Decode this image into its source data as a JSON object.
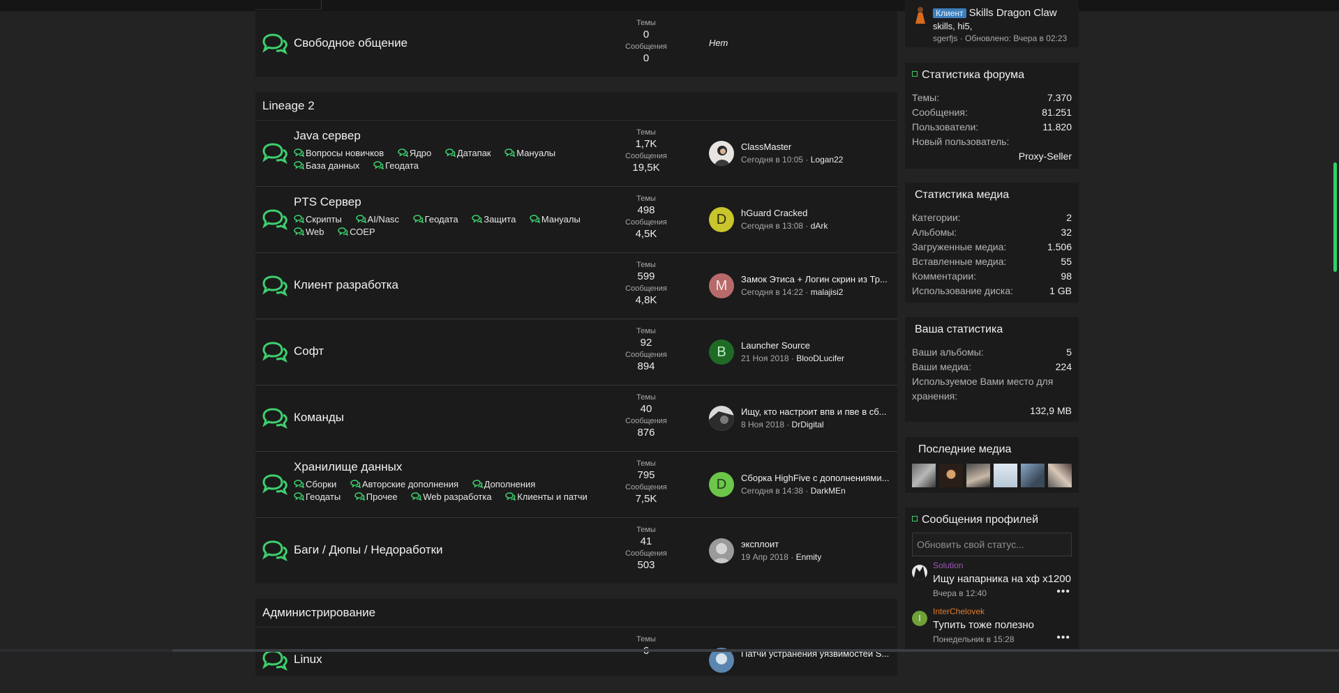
{
  "forum": {
    "lbl_threads": "Темы",
    "lbl_messages": "Сообщения",
    "top_node": {
      "title": "Свободное общение",
      "threads": "0",
      "messages": "0",
      "last_none": "Нет"
    },
    "lineage": {
      "title": "Lineage 2",
      "nodes": [
        {
          "title": "Java сервер",
          "subforums": [
            "Вопросы новичков",
            "Ядро",
            "Датапак",
            "Мануалы",
            "База данных",
            "Геодата"
          ],
          "threads": "1,7K",
          "messages": "19,5K",
          "last_title": "ClassMaster",
          "last_date": "Сегодня в 10:05",
          "last_user": "Logan22"
        },
        {
          "title": "PTS Сервер",
          "subforums": [
            "Скрипты",
            "AI/Nasc",
            "Геодата",
            "Защита",
            "Мануалы",
            "Web",
            "СОЕР"
          ],
          "threads": "498",
          "messages": "4,5K",
          "avatar_letter": "D",
          "last_title": "hGuard Cracked",
          "last_date": "Сегодня в 13:08",
          "last_user": "dArk"
        },
        {
          "title": "Клиент разработка",
          "threads": "599",
          "messages": "4,8K",
          "avatar_letter": "M",
          "last_title": "Замок Этиса + Логин скрин из Тр...",
          "last_date": "Сегодня в 14:22",
          "last_user": "malajisi2"
        },
        {
          "title": "Софт",
          "threads": "92",
          "messages": "894",
          "avatar_letter": "B",
          "last_title": "Launcher Source",
          "last_date": "21 Ноя 2018",
          "last_user": "BlooDLucifer"
        },
        {
          "title": "Команды",
          "threads": "40",
          "messages": "876",
          "last_title": "Ищу, кто настроит впв и пве в сб...",
          "last_date": "8 Ноя 2018",
          "last_user": "DrDigital"
        },
        {
          "title": "Хранилище данных",
          "subforums": [
            "Сборки",
            "Авторские дополнения",
            "Дополнения",
            "Геодаты",
            "Прочее",
            "Web разработка",
            "Клиенты и патчи"
          ],
          "threads": "795",
          "messages": "7,5K",
          "avatar_letter": "D",
          "last_title": "Сборка HighFive с дополнениями...",
          "last_date": "Сегодня в 14:38",
          "last_user": "DarkMEn"
        },
        {
          "title": "Баги / Дюпы / Недоработки",
          "threads": "41",
          "messages": "503",
          "last_title": "эксплоит",
          "last_date": "19 Апр 2018",
          "last_user": "Enmity"
        }
      ]
    },
    "admin": {
      "title": "Администрирование",
      "node": {
        "title": "Linux",
        "threads": "6",
        "last_title": "Патчи устранения уязвимостей S..."
      }
    }
  },
  "sidebar": {
    "top_post": {
      "prefix": "Клиент",
      "title": "Skills Dragon Claw",
      "snippet": "skills, hi5,",
      "meta": "sgerfjs · Обновлено: Вчера в 02:23"
    },
    "forum_stats": {
      "title": "Статистика форума",
      "rows": [
        {
          "k": "Темы:",
          "v": "7.370"
        },
        {
          "k": "Сообщения:",
          "v": "81.251"
        },
        {
          "k": "Пользователи:",
          "v": "11.820"
        },
        {
          "k": "Новый пользователь:",
          "v": ""
        }
      ],
      "new_user": "Proxy-Seller"
    },
    "media_stats": {
      "title": "Статистика медиа",
      "rows": [
        {
          "k": "Категории:",
          "v": "2"
        },
        {
          "k": "Альбомы:",
          "v": "32"
        },
        {
          "k": "Загруженные медиа:",
          "v": "1.506"
        },
        {
          "k": "Вставленные медиа:",
          "v": "55"
        },
        {
          "k": "Комментарии:",
          "v": "98"
        },
        {
          "k": "Использование диска:",
          "v": "1 GB"
        }
      ]
    },
    "your_stats": {
      "title": "Ваша статистика",
      "rows": [
        {
          "k": "Ваши альбомы:",
          "v": "5"
        },
        {
          "k": "Ваши медиа:",
          "v": "224"
        }
      ],
      "storage_label_1": "Используемое Вами место для",
      "storage_label_2": "хранения:",
      "storage_value": "132,9 MB"
    },
    "latest_media": {
      "title": "Последние медиа"
    },
    "profile_posts": {
      "title": "Сообщения профилей",
      "placeholder": "Обновить свой статус...",
      "posts": [
        {
          "user": "Solution",
          "text": "Ищу напарника на хф x1200",
          "date": "Вчера в 12:40",
          "more": "•••"
        },
        {
          "user": "InterChelovek",
          "avatar_letter": "I",
          "text": "Тупить тоже полезно",
          "date": "Понедельник в 15:28",
          "more": "•••"
        }
      ]
    }
  },
  "colors": {
    "accent_green": "#3ecf6e",
    "panel_bg": "#1b1b1b",
    "page_bg": "#232323",
    "prefix_blue": "#3d7fbd",
    "solution_purple": "#9b59b6",
    "interchelovek_orange": "#e07b2c"
  },
  "icons": {
    "node": "chat-bubbles-icon",
    "subforum": "small-chat-bubbles-icon"
  }
}
